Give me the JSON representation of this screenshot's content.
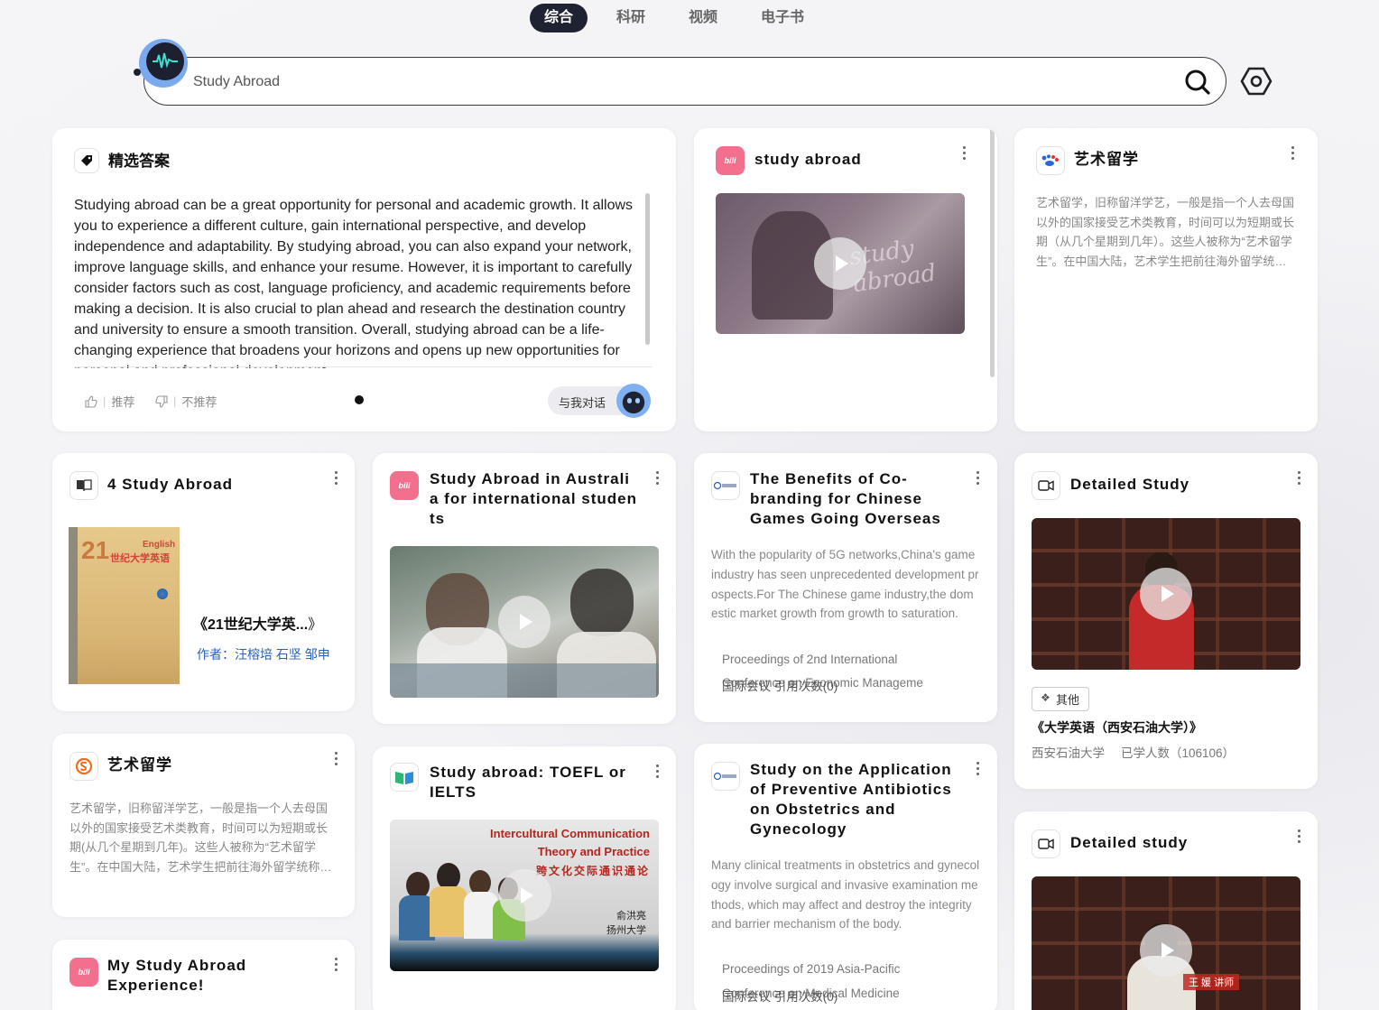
{
  "tabs": [
    {
      "label": "综合",
      "active": true
    },
    {
      "label": "科研",
      "active": false
    },
    {
      "label": "视频",
      "active": false
    },
    {
      "label": "电子书",
      "active": false
    }
  ],
  "search": {
    "value": "Study Abroad"
  },
  "answer": {
    "title": "精选答案",
    "text": "Studying abroad can be a great opportunity for personal and academic growth. It allows you to experience a different culture, gain international perspective, and develop independence and adaptability. By studying abroad, you can also expand your network, improve language skills, and enhance your resume. However, it is important to carefully consider factors such as cost, language proficiency, and academic requirements before making a decision. It is also crucial to plan ahead and research the destination country and university to ensure a smooth transition. Overall, studying abroad can be a life-changing experience that broadens your horizons and opens up new opportunities for personal and professional development.",
    "like_label": "推荐",
    "dislike_label": "不推荐",
    "chat_label": "与我对话"
  },
  "cards": {
    "video1": {
      "title": "study abroad",
      "source_icon": "bilibili-icon"
    },
    "baike1": {
      "title": "艺术留学",
      "source_icon": "baidu-icon",
      "desc": "艺术留学，旧称留洋学艺，一般是指一个人去母国以外的国家接受艺术类教育，时间可以为短期或长期（从几个星期到几年）。这些人被称为“艺术留学生”。在中国大陆，艺术学生把前往海外留学统称为艺术留学。"
    },
    "book": {
      "title": "4 Study Abroad",
      "book_title": "《21世纪大学英...",
      "book_title_close": "》",
      "author_prefix": "作者：",
      "authors": "汪榕培 石坚 邹申",
      "cover_text_1": "21",
      "cover_text_2": "English",
      "cover_text_3": "世纪大学英语"
    },
    "baike2": {
      "title": "艺术留学",
      "source_icon": "sogou-icon",
      "desc": "艺术留学，旧称留洋学艺，一般是指一个人去母国以外的国家接受艺术类教育，时间可以为短期或长期(从几个星期到几年)。这些人被称为“艺术留学生”。在中国大陆，艺术学生把前往海外留学统称为艺术留学。"
    },
    "video3": {
      "title": "My Study Abroad Experience!",
      "source_icon": "bilibili-icon"
    },
    "video2": {
      "title": "Study Abroad in Australia for international students",
      "source_icon": "bilibili-icon"
    },
    "course1": {
      "title": "Study abroad: TOEFL or IELTS",
      "source_icon": "course-icon",
      "thumb_line1": "Intercultural Communication",
      "thumb_line2": "Theory and Practice",
      "thumb_line3": "跨文化交际通识通论",
      "thumb_author": "俞洪亮",
      "thumb_org": "扬州大学"
    },
    "paper1": {
      "title": "The Benefits of Co-branding for Chinese Games Going Overseas",
      "source_icon": "paper-icon",
      "desc": "With the popularity of 5G networks,China's game industry has seen unprecedented development prospects.For The Chinese game industry,the domestic market growth from growth to saturation.",
      "venue1": "Proceedings of 2nd International",
      "venue2": "Conference on Economic Manageme",
      "overlay": "国际会议  引用次数(0)"
    },
    "paper2": {
      "title": "Study on the Application of Preventive Antibiotics on Obstetrics and Gynecology",
      "source_icon": "paper-icon",
      "desc": "Many clinical treatments in obstetrics and gynecology involve surgical and invasive examination methods, which may affect and destroy the integrity and barrier mechanism of the body.",
      "venue1": "Proceedings of 2019 Asia-Pacific",
      "venue2": "Conference on Medical Medicine",
      "overlay": "国际会议  引用次数(0)"
    },
    "mooc1": {
      "title": "Detailed Study",
      "source_icon": "video-camera-icon",
      "tag": "其他",
      "course_title": "《大学英语（西安石油大学）》",
      "school": "西安石油大学",
      "learners": "已学人数（106106）"
    },
    "mooc2": {
      "title": "Detailed study",
      "source_icon": "video-camera-icon",
      "thumb_caption": "王 媛 讲师"
    }
  }
}
